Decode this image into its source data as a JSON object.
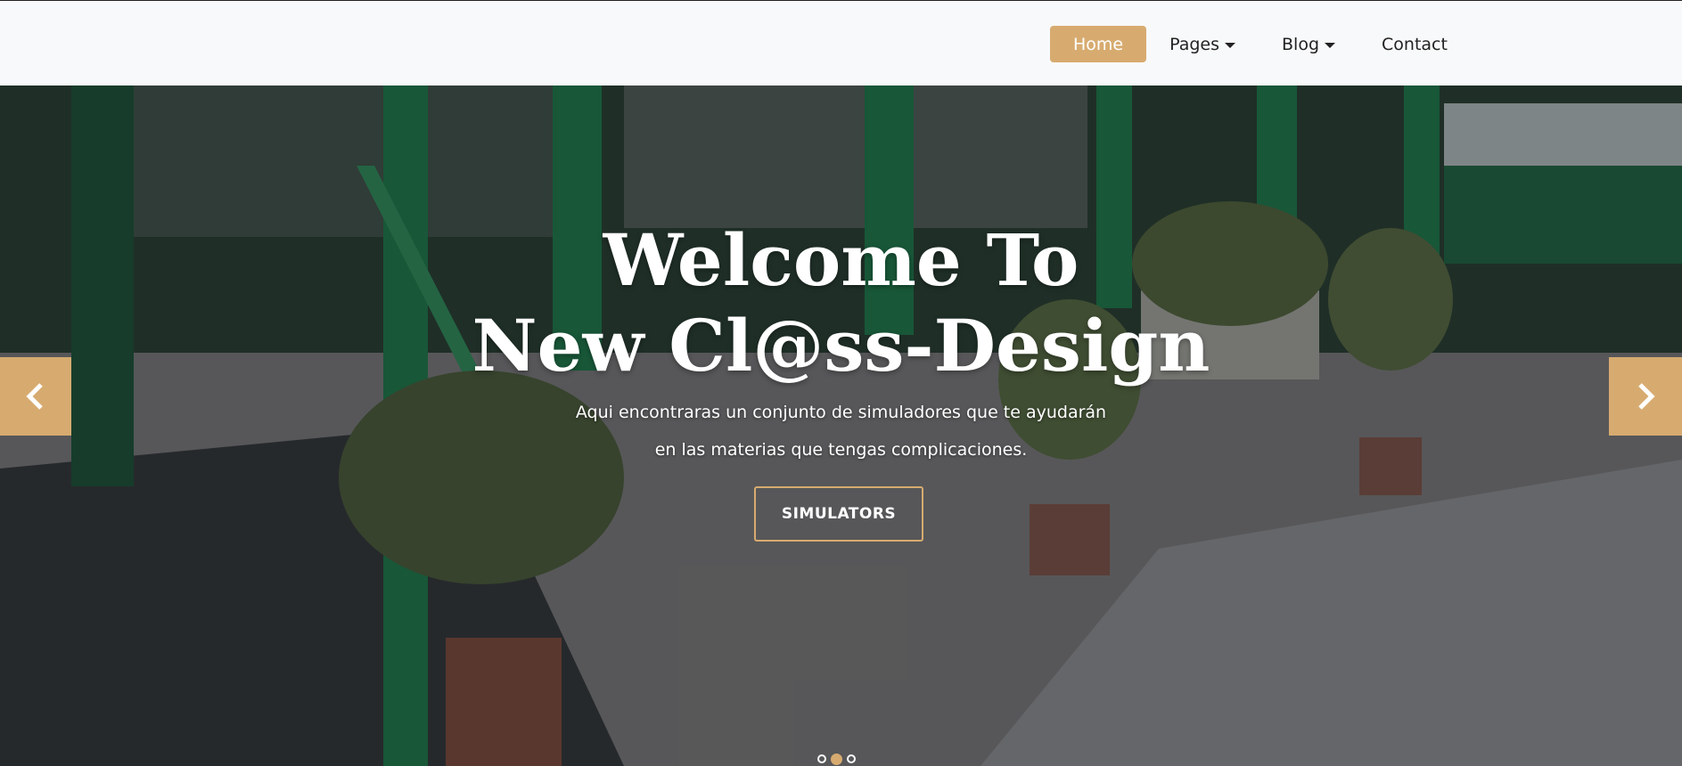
{
  "nav": {
    "items": [
      {
        "label": "Home",
        "active": true,
        "dropdown": false
      },
      {
        "label": "Pages",
        "active": false,
        "dropdown": true
      },
      {
        "label": "Blog",
        "active": false,
        "dropdown": true
      },
      {
        "label": "Contact",
        "active": false,
        "dropdown": false
      }
    ]
  },
  "hero": {
    "title_line1": "Welcome To",
    "title_line2": "New Cl@ss-Design",
    "subtitle_line1": "Aqui encontraras un conjunto de simuladores que te ayudarán",
    "subtitle_line2": "en las materias que tengas complicaciones.",
    "button_label": "SIMULATORS",
    "prev_icon": "chevron-left-icon",
    "next_icon": "chevron-right-icon",
    "slides_total": 3,
    "active_slide": 2
  },
  "colors": {
    "accent": "#d7ab70",
    "topbar_bg": "#f8f9fa"
  }
}
